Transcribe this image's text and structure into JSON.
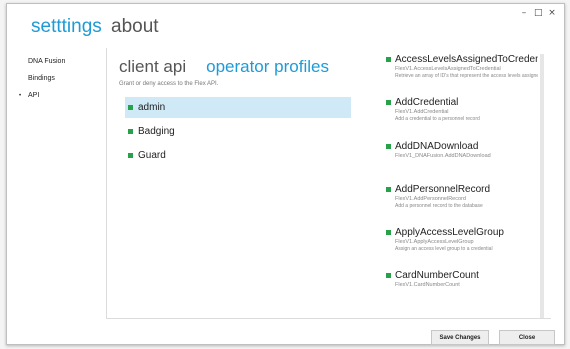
{
  "header": {
    "settings_title": "setttings",
    "about_title": "about",
    "controls": [
      "–",
      "□",
      "×"
    ]
  },
  "sidebar": {
    "items": [
      {
        "label": "DNA Fusion",
        "active": false
      },
      {
        "label": "Bindings",
        "active": false
      },
      {
        "label": "API",
        "active": true,
        "marker": "•"
      }
    ]
  },
  "main": {
    "tabs": [
      {
        "label": "client api"
      },
      {
        "label": "operator profiles",
        "active": true
      }
    ],
    "subtitle": "Grant or deny access to the Flex API.",
    "profiles": [
      {
        "label": "admin",
        "selected": true
      },
      {
        "label": "Badging",
        "selected": false
      },
      {
        "label": "Guard",
        "selected": false
      }
    ]
  },
  "api_panel": {
    "items": [
      {
        "name": "AccessLevelsAssignedToCredential",
        "method": "FlexV1.AccessLevelsAssignedToCredential",
        "desc": "Retrieve an array of ID's that represent the access levels assigned to a credential."
      },
      {
        "name": "AddCredential",
        "method": "FlexV1.AddCredential",
        "desc": "Add a credential to a personnel record"
      },
      {
        "name": "AddDNADownload",
        "method": "FlexV1_DNAFusion.AddDNADownload",
        "desc": ""
      },
      {
        "name": "AddPersonnelRecord",
        "method": "FlexV1.AddPersonnelRecord",
        "desc": "Add a personnel record to the database"
      },
      {
        "name": "ApplyAccessLevelGroup",
        "method": "FlexV1.ApplyAccessLevelGroup",
        "desc": "Assign an access level group to a credential"
      },
      {
        "name": "CardNumberCount",
        "method": "FlexV1.CardNumberCount",
        "desc": ""
      }
    ]
  },
  "footer": {
    "save_label": "Save Changes",
    "close_label": "Close"
  },
  "colors": {
    "accent": "#1e9bd7",
    "selected_bg": "#cfe9f6",
    "marker_green": "#27a24a"
  }
}
